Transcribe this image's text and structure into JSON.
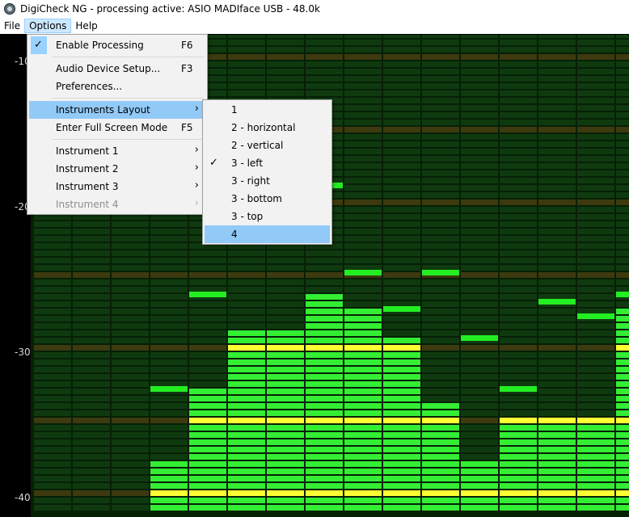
{
  "window": {
    "title": "DigiCheck NG - processing active: ASIO MADIface USB - 48.0k"
  },
  "menubar": {
    "items": [
      {
        "label": "File"
      },
      {
        "label": "Options"
      },
      {
        "label": "Help"
      }
    ]
  },
  "options_menu": {
    "items": [
      {
        "label": "Enable Processing",
        "shortcut": "F6",
        "checked": true
      },
      {
        "label": "Audio Device Setup...",
        "shortcut": "F3"
      },
      {
        "label": "Preferences..."
      },
      {
        "label": "Instruments Layout",
        "submenu": true,
        "highlighted": true
      },
      {
        "label": "Enter Full Screen Mode",
        "shortcut": "F5"
      },
      {
        "label": "Instrument 1",
        "submenu": true
      },
      {
        "label": "Instrument 2",
        "submenu": true
      },
      {
        "label": "Instrument 3",
        "submenu": true
      },
      {
        "label": "Instrument 4",
        "submenu": true,
        "disabled": true
      }
    ]
  },
  "layout_submenu": {
    "items": [
      {
        "label": "1"
      },
      {
        "label": "2 - horizontal"
      },
      {
        "label": "2 - vertical"
      },
      {
        "label": "3 - left",
        "checked": true
      },
      {
        "label": "3 - right"
      },
      {
        "label": "3 - bottom"
      },
      {
        "label": "3 - top"
      },
      {
        "label": "4",
        "highlighted": true
      }
    ]
  },
  "meter": {
    "y_labels": [
      "-10",
      "-20",
      "-30",
      "-40"
    ],
    "colors": {
      "on_green": "#33ee33",
      "off_green": "#0f3a0f",
      "yellow": "#ffff33",
      "off_yellow": "#3d3a0f",
      "peak": "#22ee22"
    },
    "columns": [
      {
        "level_db": -50,
        "peak_db": null
      },
      {
        "level_db": -50,
        "peak_db": null
      },
      {
        "level_db": -50,
        "peak_db": null
      },
      {
        "level_db": -37.5,
        "peak_db": -32.5
      },
      {
        "level_db": -32.5,
        "peak_db": -26
      },
      {
        "level_db": -28.5,
        "peak_db": -22
      },
      {
        "level_db": -28.5,
        "peak_db": -20.5
      },
      {
        "level_db": -26,
        "peak_db": -18.5
      },
      {
        "level_db": -27,
        "peak_db": -24.5
      },
      {
        "level_db": -29,
        "peak_db": -27
      },
      {
        "level_db": -33.5,
        "peak_db": -24.5
      },
      {
        "level_db": -37.5,
        "peak_db": -29
      },
      {
        "level_db": -34.5,
        "peak_db": -32.5
      },
      {
        "level_db": -34.5,
        "peak_db": -26.5
      },
      {
        "level_db": -34.5,
        "peak_db": -27.5
      },
      {
        "level_db": -27,
        "peak_db": -26
      }
    ]
  }
}
